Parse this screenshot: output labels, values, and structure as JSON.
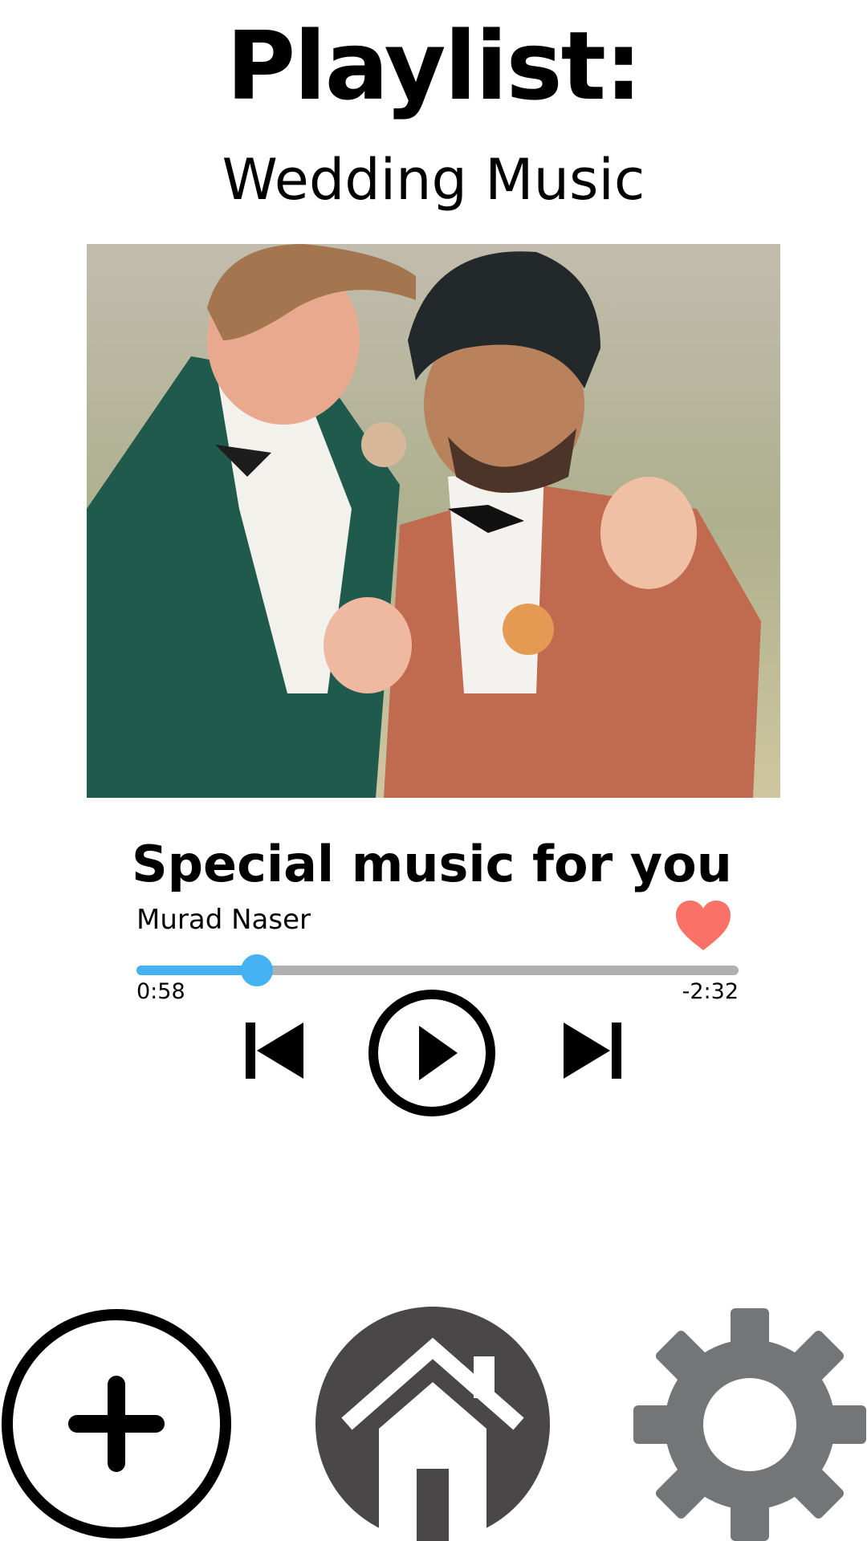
{
  "header": {
    "title": "Playlist:",
    "subtitle": "Wedding Music"
  },
  "now_playing": {
    "track_title": "Special music for you",
    "artist": "Murad Naser",
    "liked": true,
    "elapsed": "0:58",
    "remaining": "-2:32",
    "progress_fraction": 0.2
  },
  "icons": {
    "like": "heart-icon",
    "previous": "skip-previous-icon",
    "play": "play-icon",
    "next": "skip-next-icon",
    "add": "plus-circle-icon",
    "home": "home-icon",
    "settings": "gear-icon"
  },
  "colors": {
    "accent": "#44b1f2",
    "heart": "#fa7168",
    "track": "#b0b0b0",
    "home": "#4a4748",
    "settings": "#747576"
  }
}
